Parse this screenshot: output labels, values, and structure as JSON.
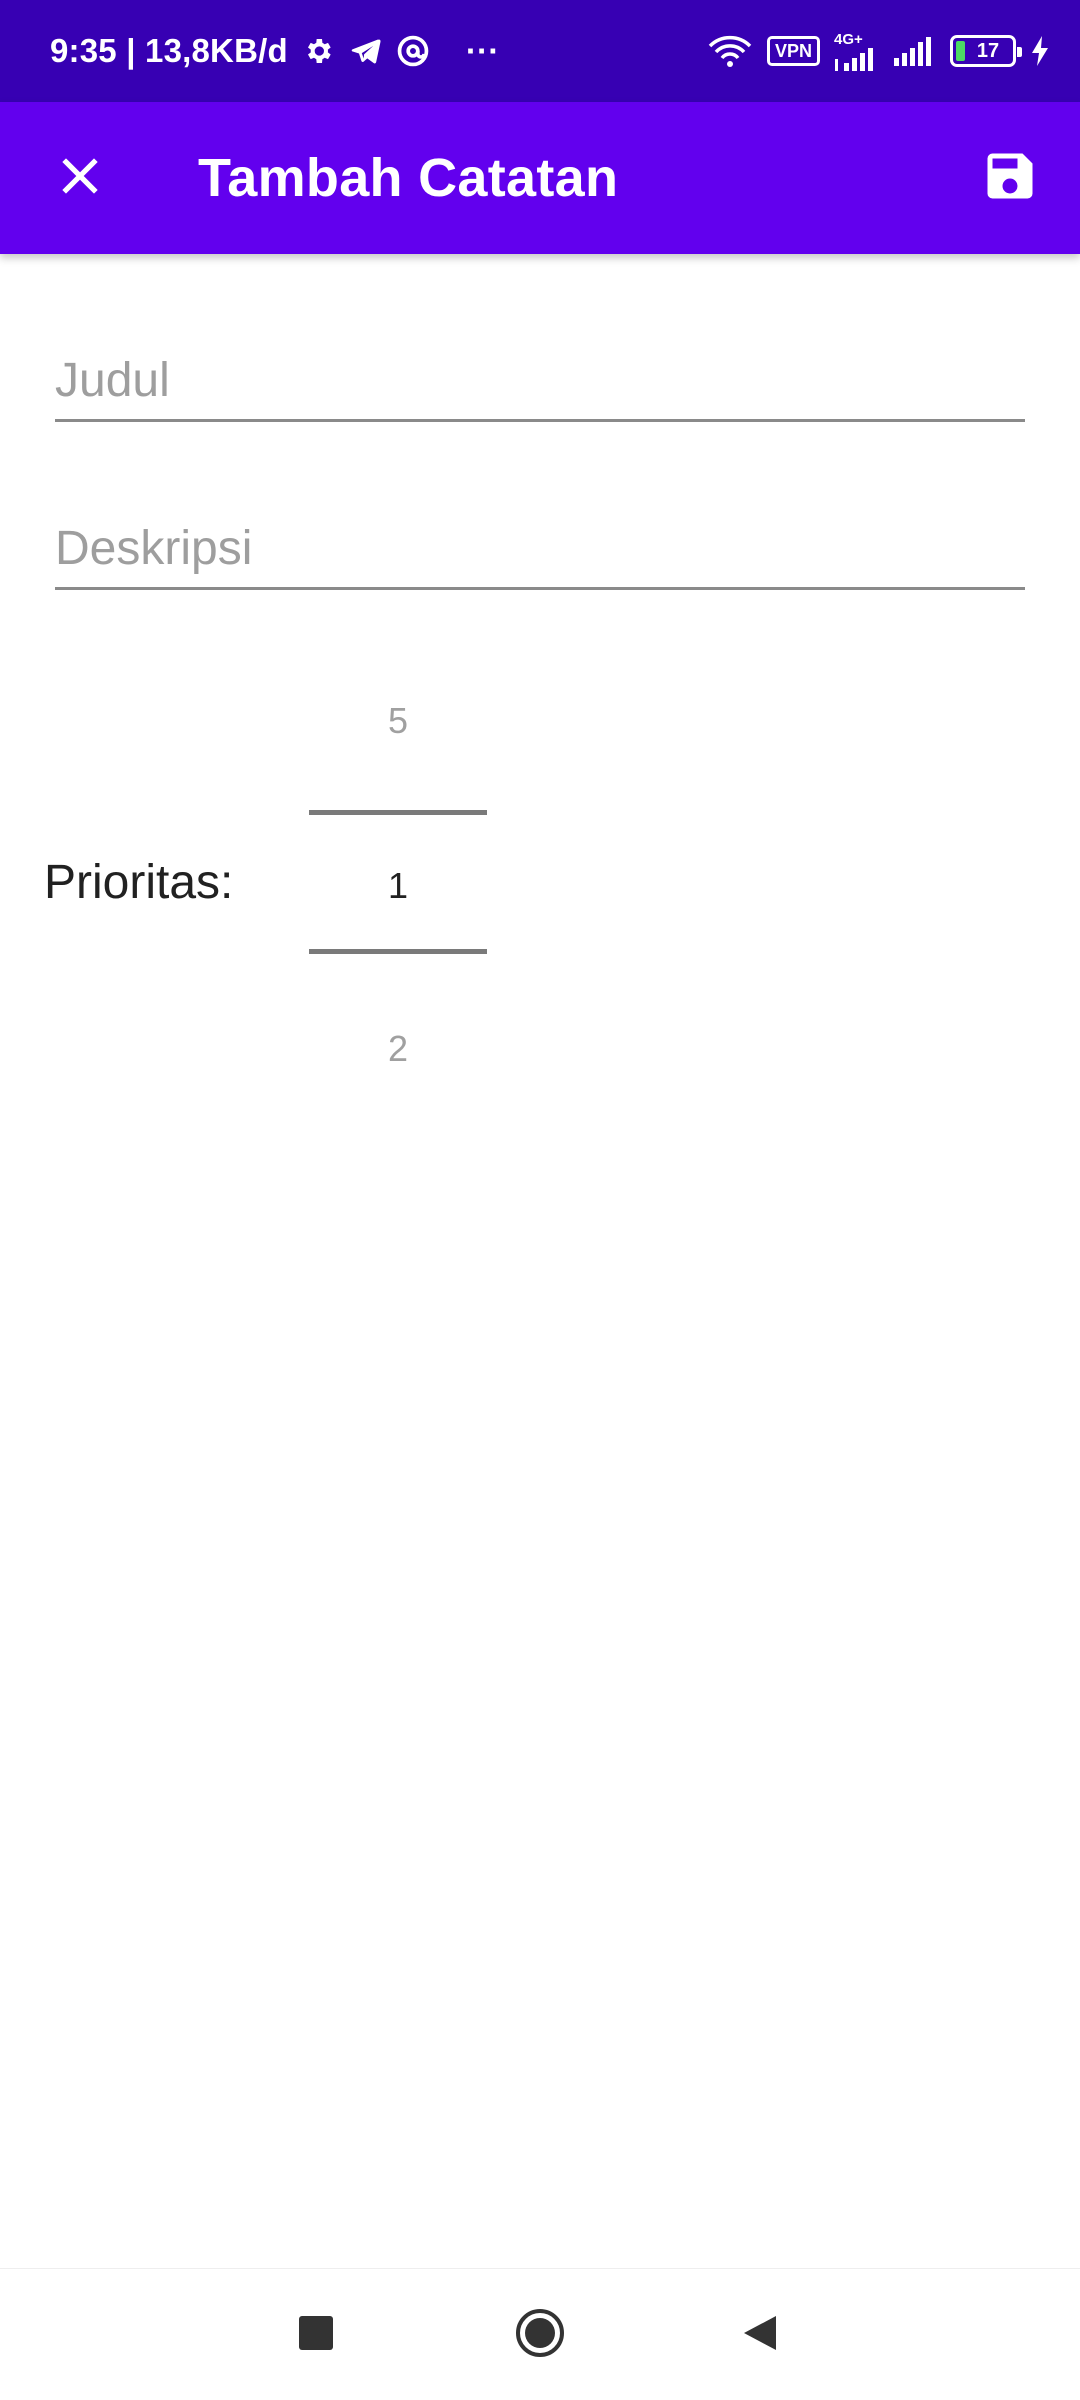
{
  "status_bar": {
    "time_speed": "9:35 | 13,8KB/d",
    "more_dots": "···",
    "vpn_label": "VPN",
    "network_type": "4G+",
    "battery_level": "17",
    "battery_fraction": 0.17,
    "icons": [
      "settings-icon",
      "telegram-icon",
      "at-sign-icon",
      "wifi-icon",
      "signal-icon",
      "charging-icon"
    ]
  },
  "app_bar": {
    "title": "Tambah Catatan",
    "close_icon": "close-icon",
    "save_icon": "save-icon",
    "background": "#6200ee",
    "status_background": "#3700b3"
  },
  "form": {
    "title_placeholder": "Judul",
    "title_value": "",
    "description_placeholder": "Deskripsi",
    "description_value": ""
  },
  "priority": {
    "label": "Prioritas:",
    "previous": "5",
    "current": "1",
    "next": "2"
  },
  "nav_bar": {
    "icons": [
      "recents-square-icon",
      "home-circle-icon",
      "back-triangle-icon"
    ]
  }
}
